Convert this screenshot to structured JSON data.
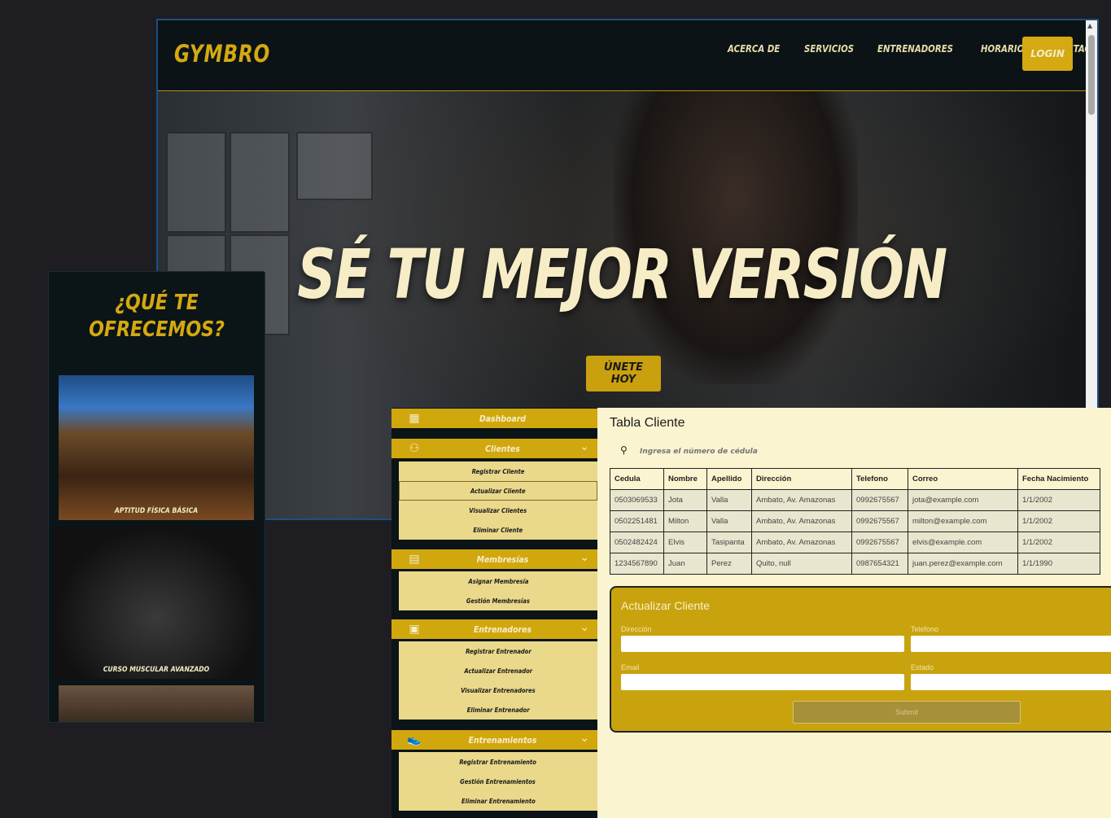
{
  "landing": {
    "brand": "GYMBRO",
    "nav": [
      "ACERCA DE",
      "SERVICIOS",
      "ENTRENADORES",
      "HORARIOS",
      "CONTACTO"
    ],
    "login": "LOGIN",
    "hero_title": "SÉ TU MEJOR VERSIÓN",
    "cta": "ÚNETE HOY"
  },
  "offers": {
    "title": "¿QUÉ TE OFRECEMOS?",
    "cards": [
      {
        "label": "APTITUD FÍSICA BÁSICA"
      },
      {
        "label": "CURSO MUSCULAR AVANZADO"
      }
    ]
  },
  "sidebar": {
    "dashboard": "Dashboard",
    "sections": [
      {
        "label": "Clientes",
        "icon": "users-icon",
        "items": [
          "Registrar Cliente",
          "Actualizar Cliente",
          "Visualizar Clientes",
          "Eliminar Cliente"
        ]
      },
      {
        "label": "Membresías",
        "icon": "badge-icon",
        "items": [
          "Asignar Membresía",
          "Gestión Membresías"
        ]
      },
      {
        "label": "Entrenadores",
        "icon": "trainer-card-icon",
        "items": [
          "Registrar Entrenador",
          "Actualizar Entrenador",
          "Visualizar Entrenadores",
          "Eliminar Entrenador"
        ]
      },
      {
        "label": "Entrenamientos",
        "icon": "sneaker-icon",
        "items": [
          "Registrar Entrenamiento",
          "Gestión Entrenamientos",
          "Eliminar Entrenamiento"
        ]
      }
    ]
  },
  "table": {
    "title": "Tabla Cliente",
    "search_placeholder": "Ingresa el número de cédula",
    "columns": [
      "Cedula",
      "Nombre",
      "Apellido",
      "Dirección",
      "Telefono",
      "Correo",
      "Fecha Nacimiento"
    ],
    "rows": [
      [
        "0503069533",
        "Jota",
        "Valla",
        "Ambato, Av. Amazonas",
        "0992675567",
        "jota@example.com",
        "1/1/2002"
      ],
      [
        "0502251481",
        "Milton",
        "Valla",
        "Ambato, Av. Amazonas",
        "0992675567",
        "milton@example.com",
        "1/1/2002"
      ],
      [
        "0502482424",
        "Elvis",
        "Tasipanta",
        "Ambato, Av. Amazonas",
        "0992675567",
        "elvis@example.com",
        "1/1/2002"
      ],
      [
        "1234567890",
        "Juan",
        "Perez",
        "Quito, null",
        "0987654321",
        "juan.perez@example.com",
        "1/1/1990"
      ]
    ]
  },
  "form": {
    "title": "Actualizar Cliente",
    "labels": [
      "Dirección",
      "Telefono",
      "Email",
      "Estado"
    ],
    "submit": "Submit"
  },
  "colors": {
    "accent": "#d4a911",
    "dark": "#0b1417",
    "cream": "#fbf4d0"
  }
}
